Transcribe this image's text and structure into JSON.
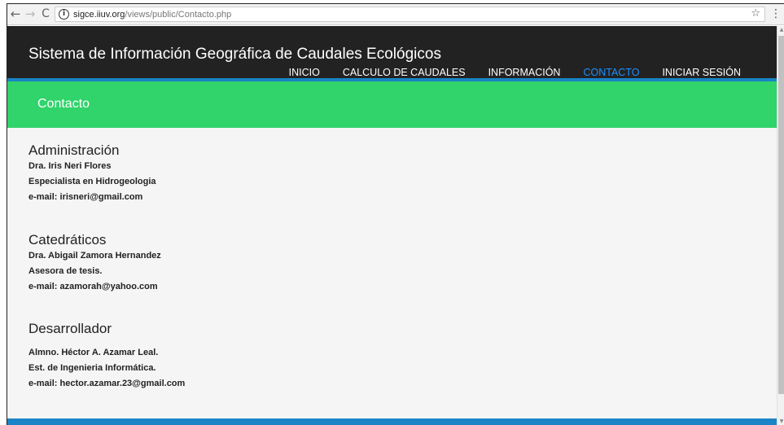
{
  "browser": {
    "back_icon": "←",
    "forward_icon": "→",
    "reload_icon": "C",
    "info_icon": "i",
    "url_host": "sigce.iiuv.org",
    "url_path": "/views/public/Contacto.php",
    "star_icon": "☆",
    "menu_icon": "⋮"
  },
  "site": {
    "title": "Sistema de Información Geográfica de Caudales Ecológicos",
    "nav": [
      {
        "label": "INICIO"
      },
      {
        "label": "CALCULO DE CAUDALES"
      },
      {
        "label": "INFORMACIÓN"
      },
      {
        "label": "CONTACTO"
      },
      {
        "label": "INICIAR SESIÓN"
      }
    ],
    "accent_color": "#1e90ff",
    "banner_color": "#31d36b",
    "stripe_color": "#1a84c7"
  },
  "banner": {
    "title": "Contacto"
  },
  "sections": [
    {
      "heading": "Administración",
      "lines": [
        "Dra. Iris Neri Flores",
        "Especialista en Hidrogeologia",
        "e-mail: irisneri@gmail.com"
      ]
    },
    {
      "heading": "Catedráticos",
      "lines": [
        "Dra. Abigail Zamora Hernandez",
        "Asesora de tesis.",
        "e-mail: azamorah@yahoo.com"
      ]
    },
    {
      "heading": "Desarrollador",
      "lines": [
        "Almno. Héctor A. Azamar Leal.",
        "Est. de Ingenieria Informática.",
        "e-mail: hector.azamar.23@gmail.com"
      ]
    }
  ],
  "scrollbar": {
    "up_icon": "▲",
    "down_icon": "▼"
  }
}
